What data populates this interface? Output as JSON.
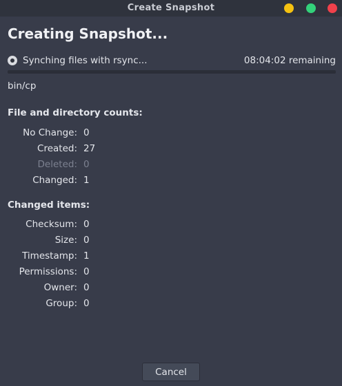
{
  "window": {
    "title": "Create Snapshot",
    "controls": {
      "minimize_color": "#f5c211",
      "maximize_color": "#33d17a",
      "close_color": "#f0414b"
    }
  },
  "heading": "Creating Snapshot...",
  "status": {
    "text": "Synching files with rsync...",
    "remaining": "08:04:02 remaining",
    "progress_fraction": 0.0
  },
  "current_file": "bin/cp",
  "counts": {
    "title": "File and directory counts:",
    "items": [
      {
        "label": "No Change:",
        "value": "0",
        "dim": false
      },
      {
        "label": "Created:",
        "value": "27",
        "dim": false
      },
      {
        "label": "Deleted:",
        "value": "0",
        "dim": true
      },
      {
        "label": "Changed:",
        "value": "1",
        "dim": false
      }
    ]
  },
  "changed": {
    "title": "Changed items:",
    "items": [
      {
        "label": "Checksum:",
        "value": "0"
      },
      {
        "label": "Size:",
        "value": "0"
      },
      {
        "label": "Timestamp:",
        "value": "1"
      },
      {
        "label": "Permissions:",
        "value": "0"
      },
      {
        "label": "Owner:",
        "value": "0"
      },
      {
        "label": "Group:",
        "value": "0"
      }
    ]
  },
  "buttons": {
    "cancel_label": "Cancel"
  }
}
